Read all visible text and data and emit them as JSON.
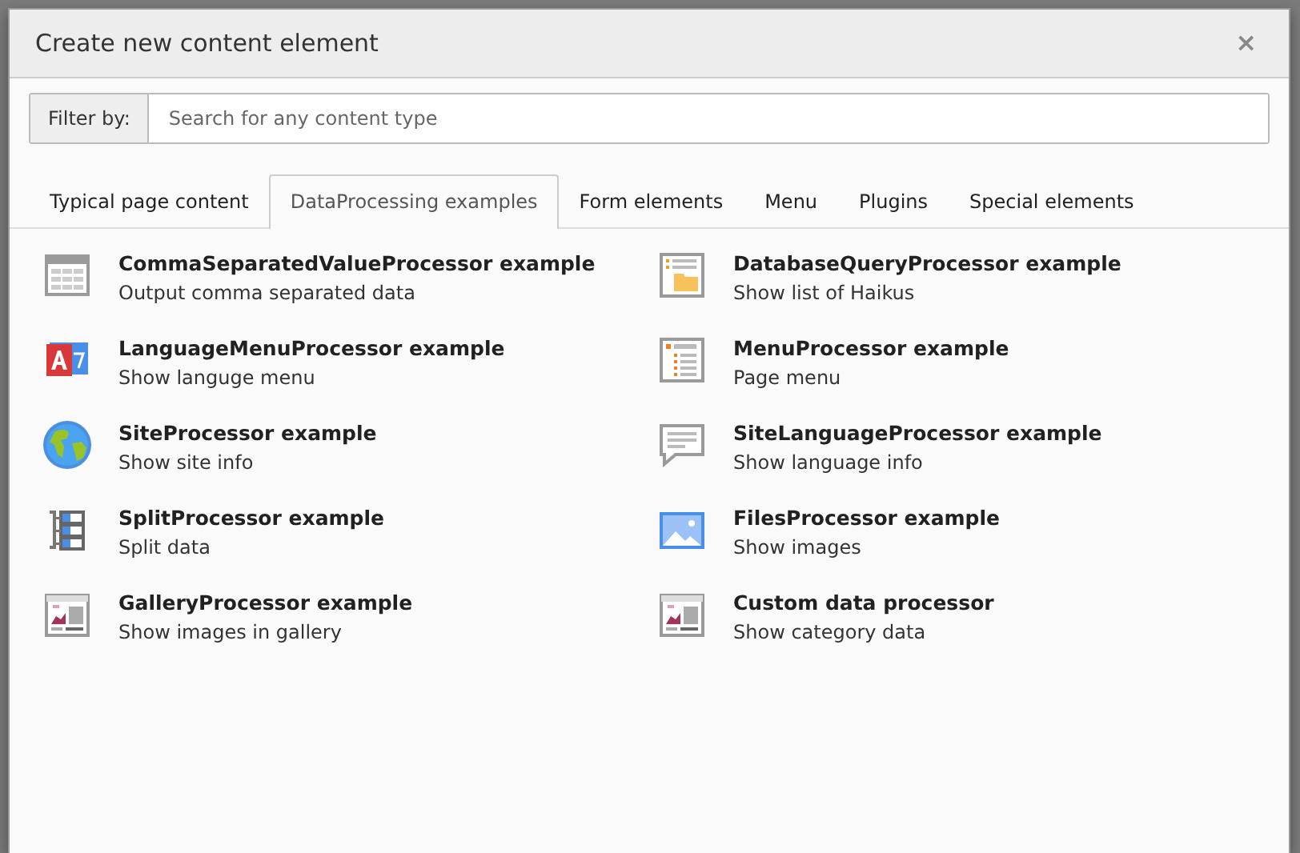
{
  "dialog": {
    "title": "Create new content element",
    "close": "×"
  },
  "filter": {
    "label": "Filter by:",
    "placeholder": "Search for any content type"
  },
  "tabs": [
    {
      "label": "Typical page content",
      "selected": false
    },
    {
      "label": "DataProcessing examples",
      "selected": true
    },
    {
      "label": "Form elements",
      "selected": false
    },
    {
      "label": "Menu",
      "selected": false
    },
    {
      "label": "Plugins",
      "selected": false
    },
    {
      "label": "Special elements",
      "selected": false
    }
  ],
  "items": [
    {
      "kind": "table",
      "title": "CommaSeparatedValueProcessor example",
      "description": "Output comma separated data"
    },
    {
      "kind": "database",
      "title": "DatabaseQueryProcessor example",
      "description": "Show list of Haikus"
    },
    {
      "kind": "language",
      "title": "LanguageMenuProcessor example",
      "description": "Show languge menu"
    },
    {
      "kind": "menu",
      "title": "MenuProcessor example",
      "description": "Page menu"
    },
    {
      "kind": "globe",
      "title": "SiteProcessor example",
      "description": "Show site info"
    },
    {
      "kind": "speech",
      "title": "SiteLanguageProcessor example",
      "description": "Show language info"
    },
    {
      "kind": "split",
      "title": "SplitProcessor example",
      "description": "Split data"
    },
    {
      "kind": "image",
      "title": "FilesProcessor example",
      "description": "Show images"
    },
    {
      "kind": "gallery",
      "title": "GalleryProcessor example",
      "description": "Show images in gallery"
    },
    {
      "kind": "gallery",
      "title": "Custom data processor",
      "description": "Show category data"
    }
  ]
}
